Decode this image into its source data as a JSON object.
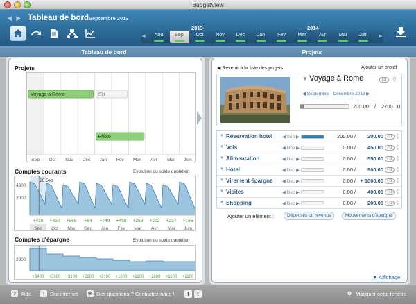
{
  "window": {
    "title": "BudgetView"
  },
  "header": {
    "nav_arrows": "◀ ▶",
    "title": "Tableau de bord",
    "subtitle": "Septembre 2013",
    "toolbar_buttons": [
      {
        "icon": "home-icon"
      },
      {
        "icon": "transactions-icon"
      },
      {
        "icon": "document-icon"
      },
      {
        "icon": "split-icon"
      },
      {
        "icon": "chart-icon"
      }
    ],
    "years": [
      "2013",
      "2014"
    ],
    "months": [
      "Aou",
      "Sep",
      "Oct",
      "Nov",
      "Dec",
      "Jan",
      "Fev",
      "Mar",
      "Avr",
      "Mai",
      "Juin"
    ],
    "selected_month": "Sep",
    "download_icon": "download-icon"
  },
  "left": {
    "panel_title": "Tableau de bord",
    "projects": {
      "title": "Projets",
      "months": [
        "Sep",
        "Oct",
        "Nov",
        "Dec",
        "Jan",
        "Fev",
        "Mar",
        "Avr",
        "Mai",
        "Juin"
      ],
      "bars": [
        {
          "label": "Voyage à Rome",
          "style": "green"
        },
        {
          "label": "Ski",
          "style": "grey"
        },
        {
          "label": "Photo",
          "style": "green"
        }
      ]
    },
    "current_accounts": {
      "title": "Comptes courants",
      "link": "Evolution du solde quotidien",
      "y_ticks": [
        "4000",
        "2000"
      ],
      "marker": "20 Sep",
      "deltas": [
        "+416",
        "+450",
        "+565",
        "+64",
        "+749",
        "+468",
        "+253",
        "+202",
        "+237",
        "+166"
      ],
      "months": [
        "Sep",
        "Oct",
        "Nov",
        "Dec",
        "Jan",
        "Fev",
        "Mar",
        "Avr",
        "Mai",
        "Juin"
      ]
    },
    "savings_accounts": {
      "title": "Comptes d'épargne",
      "link": "Evolution du solde quotidien",
      "y_ticks": [
        "2000"
      ],
      "deltas": [
        "+3400",
        "+3600",
        "+3100",
        "+2600",
        "+2100",
        "+1600",
        "+1100",
        "+1600",
        "+1100",
        "+1100"
      ]
    }
  },
  "right": {
    "panel_title": "Projets",
    "back_link": "◀ Revenir à la liste des projets",
    "add_project": "Ajouter un projet",
    "project": {
      "name": "Voyage à Rome",
      "dates": "◀ Septembre - Décembre 2013 ▶",
      "actual": "200.00",
      "separator": "/",
      "planned": "2700.00",
      "progress": 0.074
    },
    "items": [
      {
        "name": "Réservation hotel",
        "month": "◀ Sep ▶",
        "actual": "200.00",
        "planned": "200.00",
        "progress": 1.0
      },
      {
        "name": "Vols",
        "month": "◀ Nov ▶",
        "actual": "0.00",
        "planned": "450.00",
        "progress": 0
      },
      {
        "name": "Alimentation",
        "month": "◀ Dec ▶",
        "actual": "0.00",
        "planned": "550.00",
        "progress": 0
      },
      {
        "name": "Hotel",
        "month": "◀ Dec ▶",
        "actual": "0.00",
        "planned": "900.00",
        "progress": 0
      },
      {
        "name": "Virement épargne",
        "month": "◀ Dec ▶",
        "actual": "0.00",
        "planned": "+ 1000.00",
        "progress": 0
      },
      {
        "name": "Visites",
        "month": "◀ Dec ▶",
        "actual": "0.00",
        "planned": "400.00",
        "progress": 0
      },
      {
        "name": "Shopping",
        "month": "◀ Dec ▶",
        "actual": "0.00",
        "planned": "200.00",
        "progress": 0
      }
    ],
    "add_element": {
      "label": "Ajouter un élément :",
      "buttons": [
        "Dépenses ou revenus",
        "Mouvements d'épargne"
      ]
    },
    "display_link": "▼ Affichage"
  },
  "footer": {
    "help": "Aide",
    "website": "Site internet",
    "contact": "Des questions ? Contactez-nous !",
    "social": [
      "f",
      "t"
    ],
    "hide_window": "Masquer cette fenêtre"
  },
  "colors": {
    "toolbar": "#2d6a96",
    "green_bar": "#52d653",
    "project_green": "#8fd07a",
    "chart_fill": "#9cc4de",
    "chart_line": "#3d7fb0",
    "delta_green": "#4b9a3a"
  }
}
